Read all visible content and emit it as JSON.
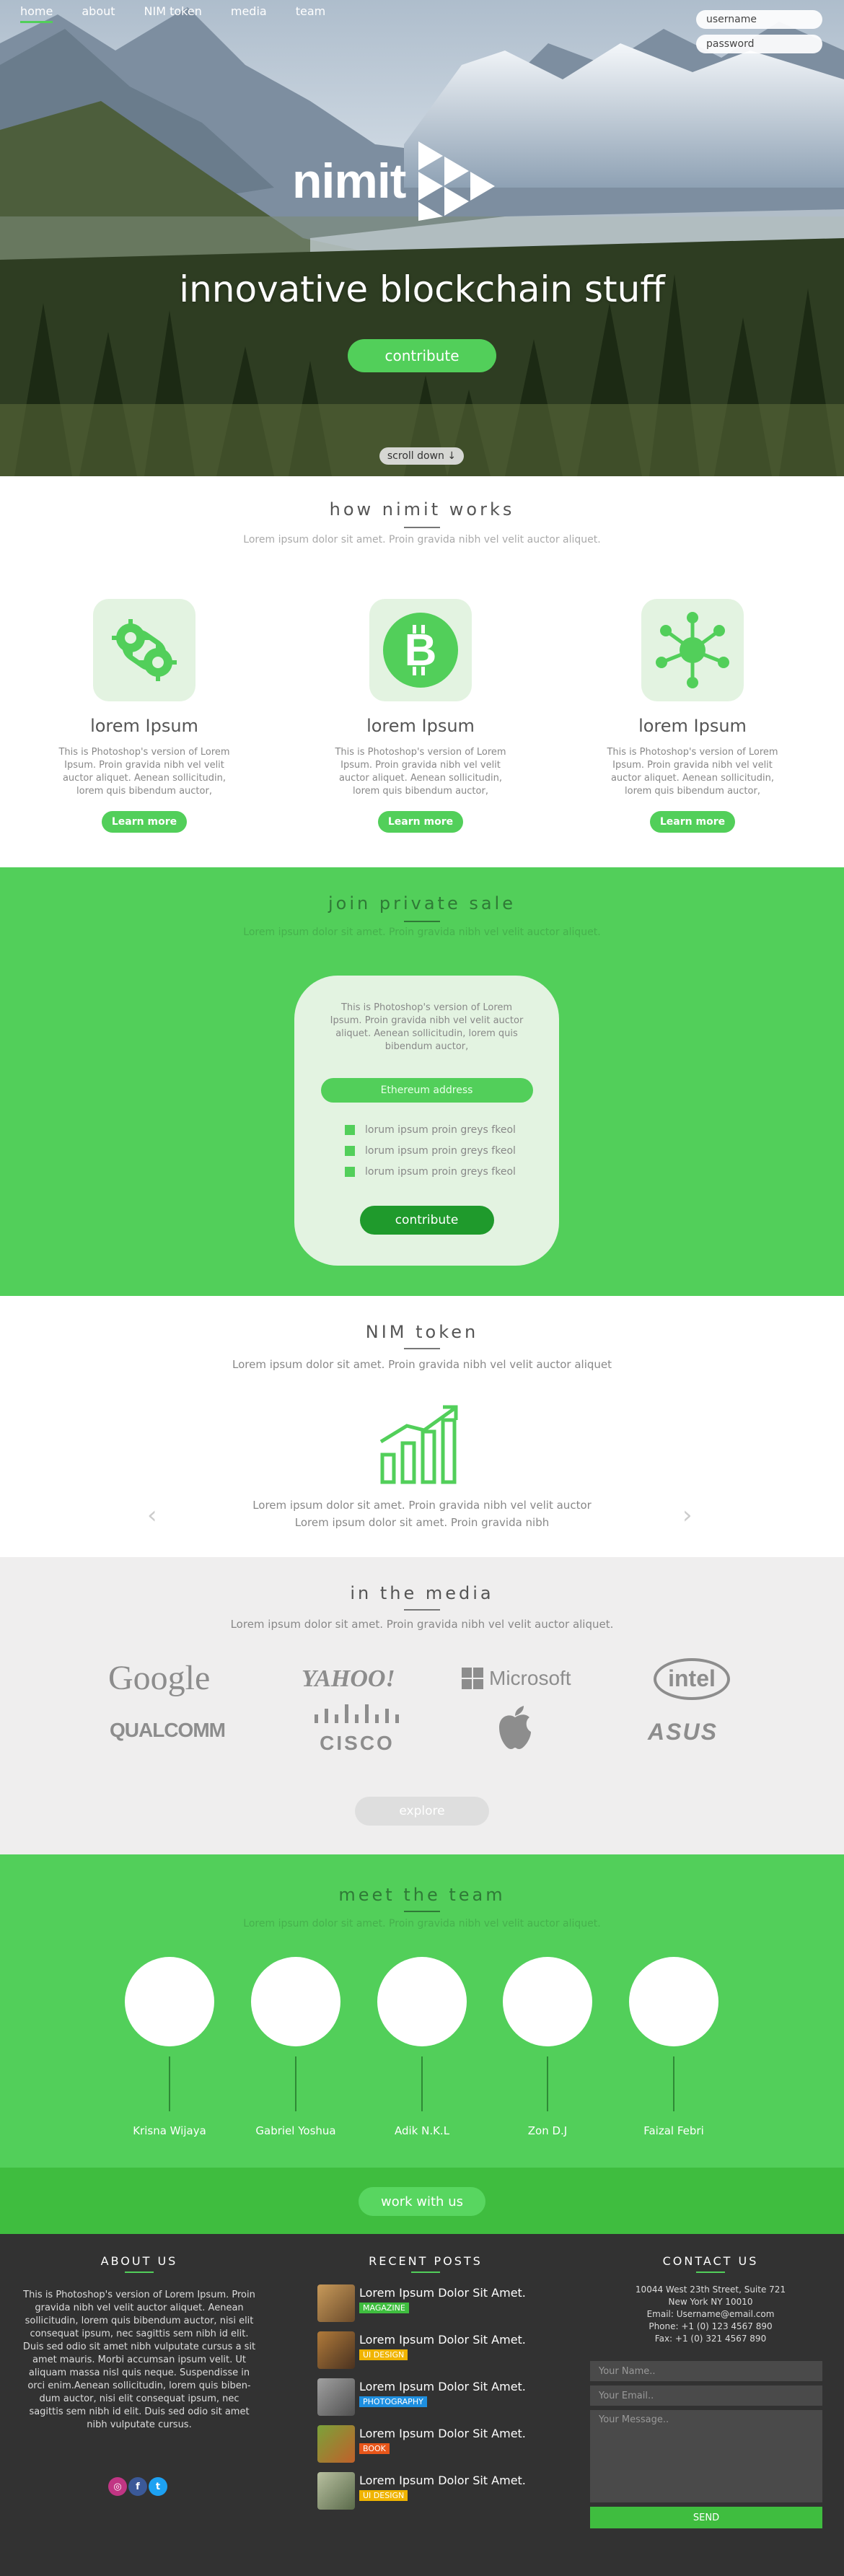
{
  "nav": {
    "items": [
      "home",
      "about",
      "NIM token",
      "media",
      "team"
    ]
  },
  "login": {
    "username_placeholder": "username",
    "password_placeholder": "password"
  },
  "hero": {
    "logo": "nimit",
    "tagline": "innovative blockchain stuff",
    "cta": "contribute",
    "scroll": "scroll down ↓"
  },
  "how": {
    "title": "how nimit works",
    "subtitle": "Lorem ipsum dolor sit amet. Proin gravida nibh vel velit auctor aliquet.",
    "features": [
      {
        "icon": "gears-icon",
        "title": "lorem Ipsum",
        "text": "This is Photoshop's version  of Lorem Ipsum. Proin gravida nibh vel velit auctor aliquet. Aenean sollicitudin, lorem quis bibendum auctor,",
        "button": "Learn more"
      },
      {
        "icon": "bitcoin-icon",
        "title": "lorem Ipsum",
        "text": "This is Photoshop's version  of Lorem Ipsum. Proin gravida nibh vel velit auctor aliquet. Aenean sollicitudin, lorem quis bibendum auctor,",
        "button": "Learn more"
      },
      {
        "icon": "network-icon",
        "title": "lorem Ipsum",
        "text": "This is Photoshop's version  of Lorem Ipsum. Proin gravida nibh vel velit auctor aliquet. Aenean sollicitudin, lorem quis bibendum auctor,",
        "button": "Learn more"
      }
    ]
  },
  "sale": {
    "title": "join private sale",
    "subtitle": "Lorem ipsum dolor sit amet. Proin gravida nibh vel velit auctor aliquet.",
    "text": "This is Photoshop's version  of Lorem Ipsum. Proin gravida nibh vel velit auctor aliquet. Aenean sollicitudin, lorem quis bibendum auctor,",
    "eth_placeholder": "Ethereum address",
    "checks": [
      "lorum ipsum proin greys fkeol",
      "lorum ipsum proin greys fkeol",
      "lorum ipsum proin greys fkeol"
    ],
    "button": "contribute"
  },
  "token": {
    "title": "NIM token",
    "subtitle": "Lorem ipsum dolor sit amet. Proin gravida nibh vel velit auctor aliquet",
    "line1": "Lorem ipsum dolor sit amet. Proin gravida nibh vel velit auctor",
    "line2": "Lorem ipsum dolor sit amet. Proin gravida nibh",
    "prev": "‹",
    "next": "›"
  },
  "media": {
    "title": "in the media",
    "subtitle": "Lorem ipsum dolor sit amet. Proin gravida nibh vel velit auctor aliquet.",
    "logos": [
      "Google",
      "YAHOO!",
      "Microsoft",
      "intel",
      "QUALCOMM",
      "CISCO",
      "apple",
      "ASUS"
    ],
    "button": "explore"
  },
  "team": {
    "title": "meet the team",
    "subtitle": "Lorem ipsum dolor sit amet. Proin gravida nibh vel velit auctor aliquet.",
    "members": [
      "Krisna Wijaya",
      "Gabriel Yoshua",
      "Adik N.K.L",
      "Zon D.J",
      "Faizal Febri"
    ],
    "work_button": "work with us"
  },
  "footer": {
    "about_title": "ABOUT US",
    "about_text": "This is Photoshop's version  of Lorem Ipsum. Proin gravida nibh vel velit auctor aliquet. Aenean sollicitudin, lorem quis bibendum auctor, nisi elit consequat ipsum, nec sagittis sem nibh id elit. Duis sed odio sit amet nibh vulputate cursus a sit amet mauris. Morbi accumsan ipsum velit. Ut aliquam massa nisl quis neque. Suspendisse in orci enim.Aenean sollicitudin, lorem quis biben-dum auctor, nisi elit consequat ipsum, nec sagittis sem nibh id elit. Duis sed odio sit amet nibh vulputate cursus.",
    "posts_title": "RECENT POSTS",
    "posts": [
      {
        "title": "Lorem Ipsum Dolor Sit Amet.",
        "tag": "MAGAZINE"
      },
      {
        "title": "Lorem Ipsum Dolor Sit Amet.",
        "tag": "UI DESIGN"
      },
      {
        "title": "Lorem Ipsum Dolor Sit Amet.",
        "tag": "PHOTOGRAPHY"
      },
      {
        "title": "Lorem Ipsum Dolor Sit Amet.",
        "tag": "BOOK"
      },
      {
        "title": "Lorem Ipsum Dolor Sit Amet.",
        "tag": "UI DESIGN"
      }
    ],
    "contact_title": "CONTACT US",
    "address1": "10044 West 23th Street, Suite 721",
    "address2": "New York NY 10010",
    "email": "Email: Username@email.com",
    "phone": "Phone: +1 (0) 123 4567 890",
    "fax": "Fax: +1 (0) 321 4567 890",
    "name_placeholder": "Your Name..",
    "email_placeholder": "Your Email..",
    "message_placeholder": "Your Message..",
    "send": "SEND"
  },
  "colors": {
    "green": "#52cf5a",
    "dark_green": "#1f9a2c",
    "footer": "#323232",
    "media_bg": "#efeeee"
  }
}
